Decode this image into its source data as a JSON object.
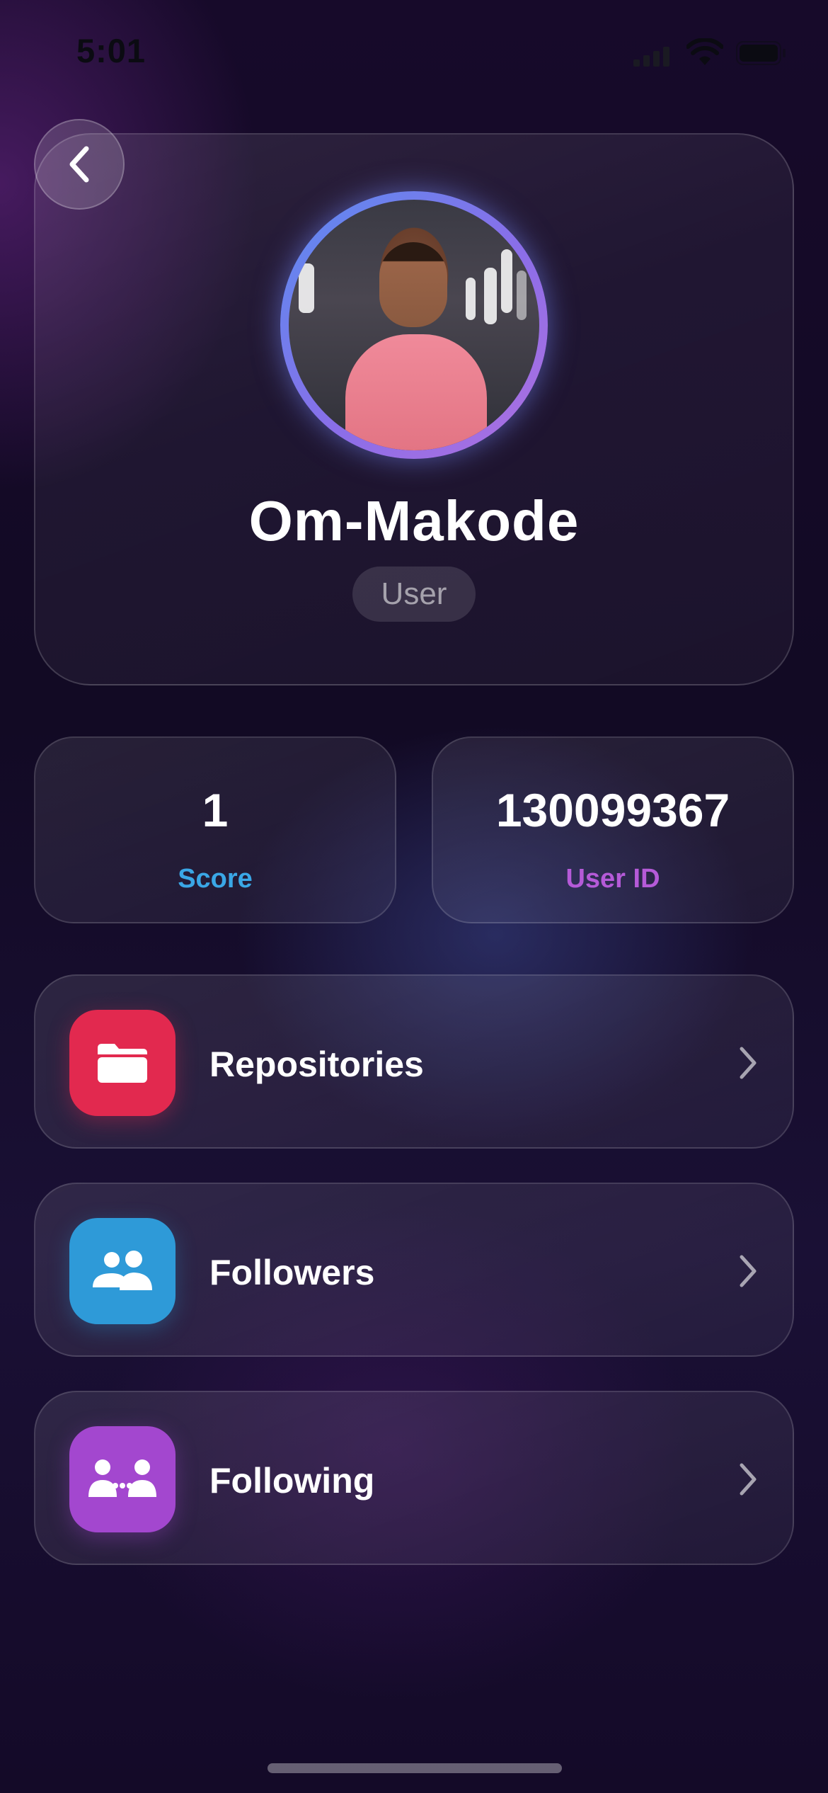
{
  "status_bar": {
    "time": "5:01"
  },
  "profile": {
    "name": "Om-Makode",
    "role": "User",
    "avatar_icon": "avatar-photo"
  },
  "stats": [
    {
      "value": "1",
      "label": "Score",
      "label_color": "#3aa7e6"
    },
    {
      "value": "130099367",
      "label": "User ID",
      "label_color": "#b55ad8"
    }
  ],
  "menu": [
    {
      "label": "Repositories",
      "icon": "folder-icon",
      "tile_color": "#e2294f"
    },
    {
      "label": "Followers",
      "icon": "people-icon",
      "tile_color": "#2e9ad8"
    },
    {
      "label": "Following",
      "icon": "people-connected-icon",
      "tile_color": "#a347cf"
    }
  ]
}
